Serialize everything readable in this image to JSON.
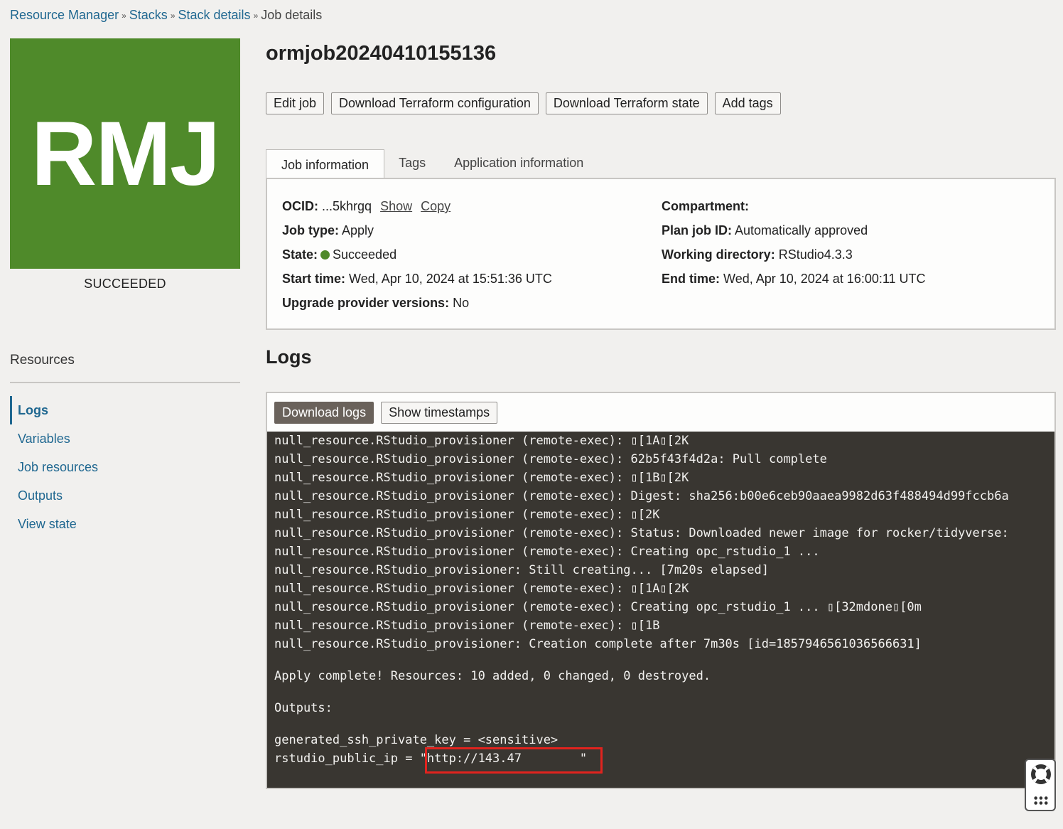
{
  "breadcrumb": {
    "items": [
      "Resource Manager",
      "Stacks",
      "Stack details"
    ],
    "separator": "»",
    "current": "Job details"
  },
  "badge": {
    "initials": "RMJ",
    "color": "#4f8a2a",
    "status": "SUCCEEDED"
  },
  "resources": {
    "title": "Resources",
    "items": [
      "Logs",
      "Variables",
      "Job resources",
      "Outputs",
      "View state"
    ],
    "active": "Logs"
  },
  "job": {
    "title": "ormjob20240410155136"
  },
  "actions": {
    "edit_job": "Edit job",
    "download_config": "Download Terraform configuration",
    "download_state": "Download Terraform state",
    "add_tags": "Add tags"
  },
  "tabs": {
    "items": [
      "Job information",
      "Tags",
      "Application information"
    ],
    "active": "Job information"
  },
  "info": {
    "ocid_label": "OCID:",
    "ocid_value": "...5khrgq",
    "show_link": "Show",
    "copy_link": "Copy",
    "job_type_label": "Job type:",
    "job_type_value": "Apply",
    "state_label": "State:",
    "state_value": "Succeeded",
    "start_time_label": "Start time:",
    "start_time_value": "Wed, Apr 10, 2024 at 15:51:36 UTC",
    "upgrade_label": "Upgrade provider versions:",
    "upgrade_value": "No",
    "compartment_label": "Compartment:",
    "compartment_value": "",
    "plan_job_label": "Plan job ID:",
    "plan_job_value": "Automatically approved",
    "working_dir_label": "Working directory:",
    "working_dir_value": "RStudio4.3.3",
    "end_time_label": "End time:",
    "end_time_value": "Wed, Apr 10, 2024 at 16:00:11 UTC",
    "state_color": "#4f8a2a"
  },
  "logs": {
    "title": "Logs",
    "download_button": "Download logs",
    "timestamps_button": "Show timestamps",
    "lines": [
      "null_resource.RStudio_provisioner (remote-exec): ▯[1A▯[2K",
      "null_resource.RStudio_provisioner (remote-exec): 62b5f43f4d2a: Pull complete",
      "null_resource.RStudio_provisioner (remote-exec): ▯[1B▯[2K",
      "null_resource.RStudio_provisioner (remote-exec): Digest: sha256:b00e6ceb90aaea9982d63f488494d99fccb6a",
      "null_resource.RStudio_provisioner (remote-exec): ▯[2K",
      "null_resource.RStudio_provisioner (remote-exec): Status: Downloaded newer image for rocker/tidyverse:",
      "null_resource.RStudio_provisioner (remote-exec): Creating opc_rstudio_1 ...",
      "null_resource.RStudio_provisioner: Still creating... [7m20s elapsed]",
      "null_resource.RStudio_provisioner (remote-exec): ▯[1A▯[2K",
      "null_resource.RStudio_provisioner (remote-exec): Creating opc_rstudio_1 ... ▯[32mdone▯[0m",
      "null_resource.RStudio_provisioner (remote-exec): ▯[1B",
      "null_resource.RStudio_provisioner: Creation complete after 7m30s [id=1857946561036566631]"
    ],
    "apply_line": "Apply complete! Resources: 10 added, 0 changed, 0 destroyed.",
    "outputs_line": "Outputs:",
    "ssh_line": "generated_ssh_private_key = <sensitive>",
    "ip_line": "rstudio_public_ip = \"http://143.47        \""
  },
  "widget": {
    "icon": "lifebuoy-icon",
    "grid_icon": "grid-icon"
  }
}
